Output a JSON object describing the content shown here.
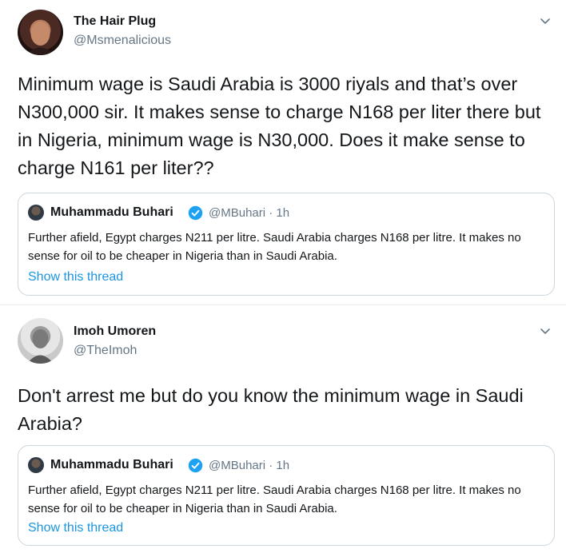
{
  "tweets": [
    {
      "author": {
        "name": "The Hair Plug",
        "handle": "@Msmenalicious"
      },
      "text": "Minimum wage is Saudi Arabia is 3000 riyals and that’s over N300,000 sir. It makes sense to charge N168 per liter there but in Nigeria, minimum wage is N30,000. Does it make sense to charge N161 per liter??",
      "quote": {
        "author_name": "Muhammadu Buhari",
        "handle_time": "@MBuhari · 1h",
        "text": "Further afield, Egypt charges N211 per litre. Saudi Arabia charges N168 per litre. It makes no sense for oil to be cheaper in Nigeria than in Saudi Arabia.",
        "link": "Show this thread"
      }
    },
    {
      "author": {
        "name": "Imoh Umoren",
        "handle": "@TheImoh"
      },
      "text": "Don't arrest me but do you know the minimum wage in Saudi Arabia?",
      "quote": {
        "author_name": "Muhammadu Buhari",
        "handle_time": "@MBuhari · 1h",
        "text": "Further afield, Egypt charges N211 per litre. Saudi Arabia charges N168 per litre. It makes no sense for oil to be cheaper in Nigeria than in Saudi Arabia.",
        "link": "Show this thread"
      }
    }
  ],
  "icons": {
    "menu": "chevron-down-icon",
    "verified": "verified-badge-icon"
  },
  "colors": {
    "link": "#1b95e0",
    "secondary_text": "#657786",
    "border": "#ccd6dd",
    "verified": "#1da1f2"
  }
}
